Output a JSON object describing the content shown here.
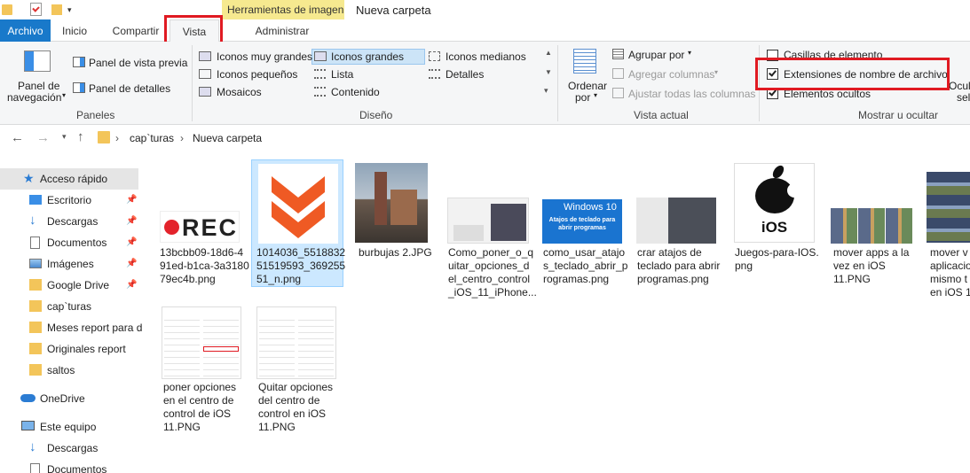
{
  "window": {
    "context_tab": "Herramientas de imagen",
    "title": "Nueva carpeta"
  },
  "tabs": [
    "Archivo",
    "Inicio",
    "Compartir",
    "Vista",
    "Administrar"
  ],
  "ribbon": {
    "panes": {
      "nav_pane": "Panel de\nnavegación",
      "nav_pane_line1": "Panel de",
      "nav_pane_line2": "navegación",
      "preview": "Panel de vista previa",
      "details": "Panel de detalles",
      "group": "Paneles"
    },
    "layout": {
      "items": [
        "Iconos muy grandes",
        "Iconos grandes",
        "Iconos medianos",
        "Iconos pequeños",
        "Lista",
        "Detalles",
        "Mosaicos",
        "Contenido"
      ],
      "group": "Diseño"
    },
    "current_view": {
      "sort_line1": "Ordenar",
      "sort_line2": "por",
      "group_by": "Agrupar por",
      "add_columns": "Agregar columnas",
      "fit_columns": "Ajustar todas las columnas",
      "group": "Vista actual"
    },
    "show_hide": {
      "checkboxes": "Casillas de elemento",
      "extensions": "Extensiones de nombre de archivo",
      "hidden": "Elementos ocultos",
      "hide_line1": "Ocult",
      "hide_line2": "sel",
      "group": "Mostrar u ocultar"
    }
  },
  "address": {
    "crumbs": [
      "cap`turas",
      "Nueva carpeta"
    ]
  },
  "nav": {
    "items": [
      "Acceso rápido",
      "Escritorio",
      "Descargas",
      "Documentos",
      "Imágenes",
      "Google Drive",
      "cap`turas",
      "Meses report para d",
      "Originales report",
      "saltos",
      "OneDrive",
      "Este equipo",
      "Descargas",
      "Documentos"
    ]
  },
  "files": [
    {
      "name": "13bcbb09-18d6-491ed-b1ca-3a318079ec4b.png",
      "lines": [
        "13bcbb09-18d6-4",
        "91ed-b1ca-3a3180",
        "79ec4b.png"
      ],
      "thumb_text": "REC"
    },
    {
      "name": "1014036_551883251519593_36925551_n.png",
      "lines": [
        "1014036_5518832",
        "51519593_369255",
        "51_n.png"
      ]
    },
    {
      "name": "burbujas 2.JPG",
      "lines": [
        "burbujas 2.JPG"
      ]
    },
    {
      "name": "Como_poner_o_quitar_opciones_del_centro_control_iOS_11_iPhone...",
      "lines": [
        "Como_poner_o_q",
        "uitar_opciones_d",
        "el_centro_control",
        "_iOS_11_iPhone..."
      ]
    },
    {
      "name": "como_usar_atajos_teclado_abrir_programas.png",
      "lines": [
        "como_usar_atajo",
        "s_teclado_abrir_p",
        "rogramas.png"
      ],
      "thumb_title": "Windows 10",
      "thumb_sub": "Atajos de teclado para abrir programas"
    },
    {
      "name": "crar atajos de teclado para abrir programas.png",
      "lines": [
        "crar atajos de",
        "teclado para abrir",
        "programas.png"
      ]
    },
    {
      "name": "Juegos-para-IOS.png",
      "lines": [
        "Juegos-para-IOS.",
        "png"
      ],
      "thumb_text": "iOS"
    },
    {
      "name": "mover apps a la vez en iOS 11.PNG",
      "lines": [
        "mover apps a la",
        "vez en iOS",
        "11.PNG"
      ]
    },
    {
      "name": "mover v aplicacio mismo t en iOS 1",
      "lines": [
        "mover v",
        "aplicacio",
        "mismo t",
        "en iOS 1"
      ]
    },
    {
      "name": "poner opciones en el centro de control de iOS 11.PNG",
      "lines": [
        "poner opciones",
        "en el centro de",
        "control de iOS",
        "11.PNG"
      ]
    },
    {
      "name": "Quitar opciones del centro de control en iOS 11.PNG",
      "lines": [
        "Quitar opciones",
        "del centro de",
        "control en iOS",
        "11.PNG"
      ]
    }
  ],
  "colors": {
    "accent": "#1979ca",
    "highlight": "#e01a22",
    "context": "#f6e98f",
    "selection": "#cce8ff"
  }
}
